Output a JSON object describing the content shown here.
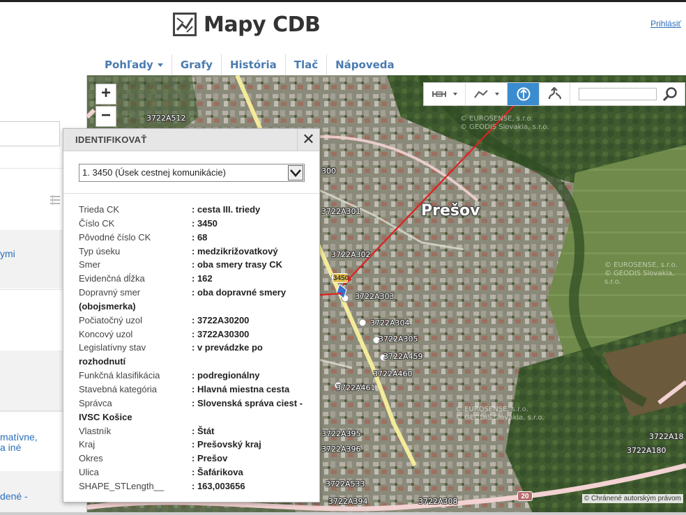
{
  "header": {
    "app_title": "Mapy CDB",
    "login_label": "Prihlásiť"
  },
  "nav": {
    "items": [
      {
        "label": "Pohľady"
      },
      {
        "label": "Grafy"
      },
      {
        "label": "História"
      },
      {
        "label": "Tlač"
      },
      {
        "label": "Nápoveda"
      }
    ]
  },
  "sidebar": {
    "links": [
      {
        "label": "ymi"
      },
      {
        "label": "matívne,"
      },
      {
        "label": "a iné"
      },
      {
        "label": "dené -"
      }
    ]
  },
  "map": {
    "zoom_in": "+",
    "zoom_out": "−",
    "city_label": "Prešov",
    "node_labels": [
      "3722A512",
      "300",
      "3722A301",
      "3722A302",
      "3722A303",
      "3722A304",
      "3722A305",
      "3722A459",
      "3722A460",
      "3722A461",
      "3722A395",
      "3722A396",
      "3722A533",
      "3722A394",
      "3722A308",
      "3722A180",
      "3722A18"
    ],
    "road_badges": [
      {
        "label": "3450"
      },
      {
        "label": "20"
      }
    ],
    "watermarks": [
      {
        "line1": "© EUROSENSE, s.r.o.",
        "line2": "© GEODIS Slovakia, s.r.o."
      },
      {
        "line1": "© EUROSENSE, s.r.o.",
        "line2": "© GEODIS Slovakia, s.r.o."
      },
      {
        "line1": "© EUROSENSE, s.r.o.",
        "line2": "© GEODIS Slovakia, s.r.o."
      }
    ],
    "copyright": "© Chránené autorským právom",
    "accent_color": "#3b8ccf",
    "arrow_color": "#e02020"
  },
  "identify": {
    "title": "IDENTIFIKOVAŤ",
    "close": "✕",
    "selected": "1. 3450 (Úsek cestnej komunikácie)",
    "attributes": [
      {
        "key": "Trieda CK",
        "value": ": cesta III. triedy"
      },
      {
        "key": "Číslo CK",
        "value": ": 3450"
      },
      {
        "key": "Pôvodné číslo CK",
        "value": ": 68"
      },
      {
        "key": "Typ úseku",
        "value": ": medzikrižovatkový"
      },
      {
        "key": "Smer",
        "value": ": oba smery trasy CK"
      },
      {
        "key": "Evidenčná dĺžka",
        "value": ": 162"
      },
      {
        "key": "Dopravný smer",
        "value": ": oba dopravné smery",
        "continuation": "(obojsmerka)"
      },
      {
        "key": "Počiatočný uzol",
        "value": ": 3722A30200"
      },
      {
        "key": "Koncový uzol",
        "value": ": 3722A30300"
      },
      {
        "key": "Legislatívny stav",
        "value": ": v prevádzke po",
        "continuation": "rozhodnutí"
      },
      {
        "key": "Funkčná klasifikácia",
        "value": ": podregionálny"
      },
      {
        "key": "Stavebná kategória",
        "value": ": Hlavná miestna cesta"
      },
      {
        "key": "Správca",
        "value": ": Slovenská správa ciest -",
        "continuation": "IVSC Košice"
      },
      {
        "key": "Vlastník",
        "value": ": Štát"
      },
      {
        "key": "Kraj",
        "value": ": Prešovský kraj"
      },
      {
        "key": "Okres",
        "value": ": Prešov"
      },
      {
        "key": "Ulica",
        "value": ": Šafárikova"
      },
      {
        "key": "SHAPE_STLength__",
        "value": ": 163,003656"
      }
    ]
  }
}
